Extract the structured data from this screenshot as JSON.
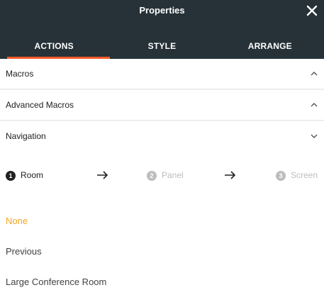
{
  "header": {
    "title": "Properties",
    "close_icon": "close-icon"
  },
  "tabs": [
    {
      "label": "ACTIONS",
      "active": true
    },
    {
      "label": "STYLE",
      "active": false
    },
    {
      "label": "ARRANGE",
      "active": false
    }
  ],
  "sections": [
    {
      "label": "Macros",
      "chevron": "chevron-up-icon"
    },
    {
      "label": "Advanced Macros",
      "chevron": "chevron-up-icon"
    },
    {
      "label": "Navigation",
      "chevron": "chevron-down-icon"
    }
  ],
  "stepper": {
    "steps": [
      {
        "number": "1",
        "label": "Room",
        "active": true
      },
      {
        "number": "2",
        "label": "Panel",
        "active": false
      },
      {
        "number": "3",
        "label": "Screen",
        "active": false
      }
    ]
  },
  "options": [
    {
      "label": "None",
      "selected": true
    },
    {
      "label": "Previous",
      "selected": false
    },
    {
      "label": "Large Conference Room",
      "selected": false
    }
  ],
  "colors": {
    "header_bg": "#263238",
    "tab_indicator": "#ff5a2c",
    "selected_option": "#f5a623",
    "active_step": "#212121",
    "inactive_step": "#bdbdbd"
  }
}
